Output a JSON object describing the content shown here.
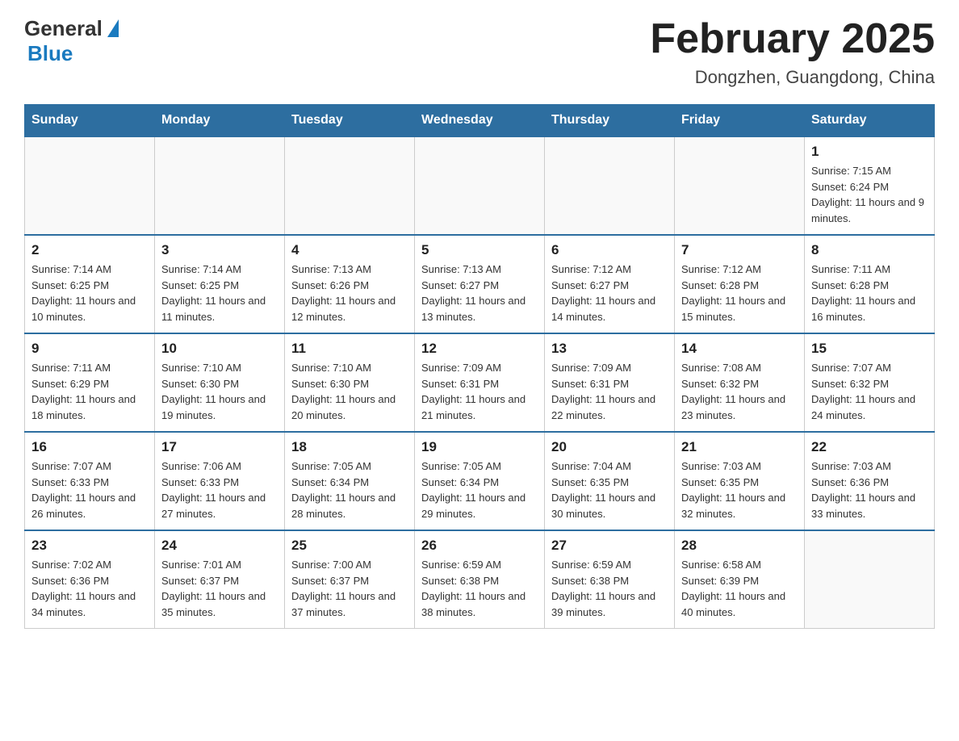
{
  "header": {
    "logo": {
      "general": "General",
      "blue": "Blue"
    },
    "title": "February 2025",
    "subtitle": "Dongzhen, Guangdong, China"
  },
  "days_of_week": [
    "Sunday",
    "Monday",
    "Tuesday",
    "Wednesday",
    "Thursday",
    "Friday",
    "Saturday"
  ],
  "weeks": [
    [
      {
        "day": "",
        "info": ""
      },
      {
        "day": "",
        "info": ""
      },
      {
        "day": "",
        "info": ""
      },
      {
        "day": "",
        "info": ""
      },
      {
        "day": "",
        "info": ""
      },
      {
        "day": "",
        "info": ""
      },
      {
        "day": "1",
        "info": "Sunrise: 7:15 AM\nSunset: 6:24 PM\nDaylight: 11 hours and 9 minutes."
      }
    ],
    [
      {
        "day": "2",
        "info": "Sunrise: 7:14 AM\nSunset: 6:25 PM\nDaylight: 11 hours and 10 minutes."
      },
      {
        "day": "3",
        "info": "Sunrise: 7:14 AM\nSunset: 6:25 PM\nDaylight: 11 hours and 11 minutes."
      },
      {
        "day": "4",
        "info": "Sunrise: 7:13 AM\nSunset: 6:26 PM\nDaylight: 11 hours and 12 minutes."
      },
      {
        "day": "5",
        "info": "Sunrise: 7:13 AM\nSunset: 6:27 PM\nDaylight: 11 hours and 13 minutes."
      },
      {
        "day": "6",
        "info": "Sunrise: 7:12 AM\nSunset: 6:27 PM\nDaylight: 11 hours and 14 minutes."
      },
      {
        "day": "7",
        "info": "Sunrise: 7:12 AM\nSunset: 6:28 PM\nDaylight: 11 hours and 15 minutes."
      },
      {
        "day": "8",
        "info": "Sunrise: 7:11 AM\nSunset: 6:28 PM\nDaylight: 11 hours and 16 minutes."
      }
    ],
    [
      {
        "day": "9",
        "info": "Sunrise: 7:11 AM\nSunset: 6:29 PM\nDaylight: 11 hours and 18 minutes."
      },
      {
        "day": "10",
        "info": "Sunrise: 7:10 AM\nSunset: 6:30 PM\nDaylight: 11 hours and 19 minutes."
      },
      {
        "day": "11",
        "info": "Sunrise: 7:10 AM\nSunset: 6:30 PM\nDaylight: 11 hours and 20 minutes."
      },
      {
        "day": "12",
        "info": "Sunrise: 7:09 AM\nSunset: 6:31 PM\nDaylight: 11 hours and 21 minutes."
      },
      {
        "day": "13",
        "info": "Sunrise: 7:09 AM\nSunset: 6:31 PM\nDaylight: 11 hours and 22 minutes."
      },
      {
        "day": "14",
        "info": "Sunrise: 7:08 AM\nSunset: 6:32 PM\nDaylight: 11 hours and 23 minutes."
      },
      {
        "day": "15",
        "info": "Sunrise: 7:07 AM\nSunset: 6:32 PM\nDaylight: 11 hours and 24 minutes."
      }
    ],
    [
      {
        "day": "16",
        "info": "Sunrise: 7:07 AM\nSunset: 6:33 PM\nDaylight: 11 hours and 26 minutes."
      },
      {
        "day": "17",
        "info": "Sunrise: 7:06 AM\nSunset: 6:33 PM\nDaylight: 11 hours and 27 minutes."
      },
      {
        "day": "18",
        "info": "Sunrise: 7:05 AM\nSunset: 6:34 PM\nDaylight: 11 hours and 28 minutes."
      },
      {
        "day": "19",
        "info": "Sunrise: 7:05 AM\nSunset: 6:34 PM\nDaylight: 11 hours and 29 minutes."
      },
      {
        "day": "20",
        "info": "Sunrise: 7:04 AM\nSunset: 6:35 PM\nDaylight: 11 hours and 30 minutes."
      },
      {
        "day": "21",
        "info": "Sunrise: 7:03 AM\nSunset: 6:35 PM\nDaylight: 11 hours and 32 minutes."
      },
      {
        "day": "22",
        "info": "Sunrise: 7:03 AM\nSunset: 6:36 PM\nDaylight: 11 hours and 33 minutes."
      }
    ],
    [
      {
        "day": "23",
        "info": "Sunrise: 7:02 AM\nSunset: 6:36 PM\nDaylight: 11 hours and 34 minutes."
      },
      {
        "day": "24",
        "info": "Sunrise: 7:01 AM\nSunset: 6:37 PM\nDaylight: 11 hours and 35 minutes."
      },
      {
        "day": "25",
        "info": "Sunrise: 7:00 AM\nSunset: 6:37 PM\nDaylight: 11 hours and 37 minutes."
      },
      {
        "day": "26",
        "info": "Sunrise: 6:59 AM\nSunset: 6:38 PM\nDaylight: 11 hours and 38 minutes."
      },
      {
        "day": "27",
        "info": "Sunrise: 6:59 AM\nSunset: 6:38 PM\nDaylight: 11 hours and 39 minutes."
      },
      {
        "day": "28",
        "info": "Sunrise: 6:58 AM\nSunset: 6:39 PM\nDaylight: 11 hours and 40 minutes."
      },
      {
        "day": "",
        "info": ""
      }
    ]
  ]
}
